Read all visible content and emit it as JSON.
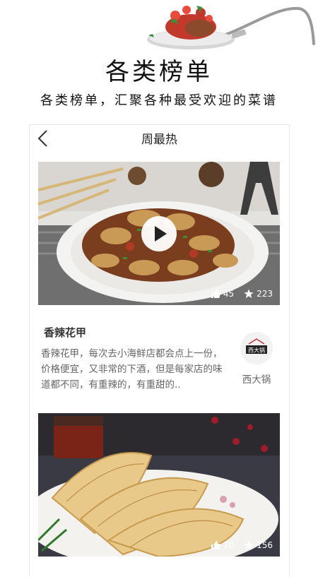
{
  "hero": {
    "title": "各类榜单",
    "subtitle": "各类榜单，汇聚各种最受欢迎的菜谱"
  },
  "topbar": {
    "title": "周最热",
    "back_icon": "chevron-left-icon"
  },
  "cards": [
    {
      "image": "clams-dish-photo",
      "likes": "45",
      "stars": "223",
      "title": "香辣花甲",
      "description": "香辣花甲，每次去小海鲜店都会点上一份，价格便宜，又非常的下酒，但是每家店的味道都不同，有重辣的，有重甜的..",
      "author": "西大锅",
      "author_logo_text": "西大锅"
    },
    {
      "image": "scallion-pancake-photo",
      "likes": "70",
      "stars": "156"
    }
  ],
  "colors": {
    "text_primary": "#222222",
    "text_secondary": "#666666",
    "border": "#e6e6e6",
    "overlay_text": "#ffffff"
  }
}
